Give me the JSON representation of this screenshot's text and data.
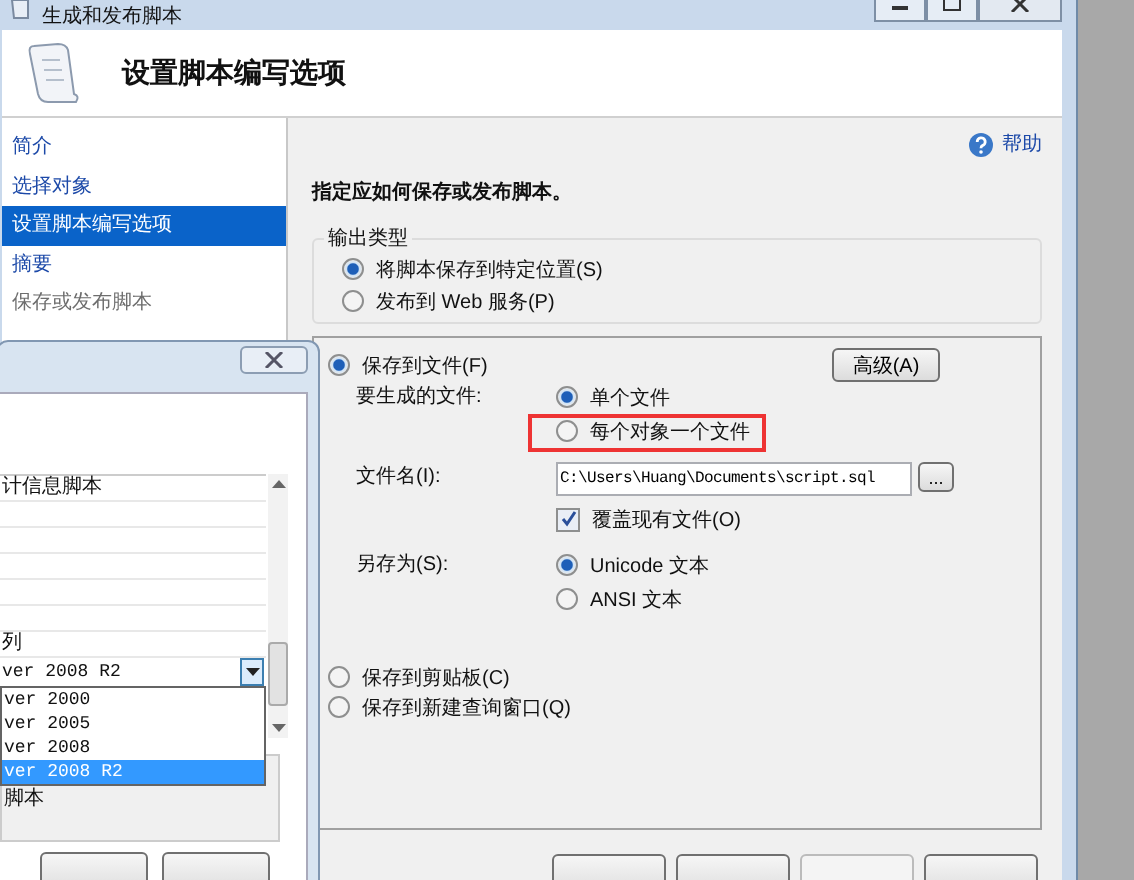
{
  "window": {
    "title": "生成和发布脚本"
  },
  "header": {
    "title": "设置脚本编写选项"
  },
  "nav": {
    "items": [
      {
        "label": "简介",
        "selected": false,
        "disabled": false
      },
      {
        "label": "选择对象",
        "selected": false,
        "disabled": false
      },
      {
        "label": "设置脚本编写选项",
        "selected": true,
        "disabled": false
      },
      {
        "label": "摘要",
        "selected": false,
        "disabled": false
      },
      {
        "label": "保存或发布脚本",
        "selected": false,
        "disabled": true
      }
    ]
  },
  "help": {
    "label": "帮助"
  },
  "instruction": "指定应如何保存或发布脚本。",
  "output_type": {
    "title": "输出类型",
    "options": [
      {
        "label": "将脚本保存到特定位置(S)",
        "selected": true
      },
      {
        "label": "发布到 Web 服务(P)",
        "selected": false
      }
    ]
  },
  "save_panel": {
    "save_to_file": {
      "label": "保存到文件(F)",
      "selected": true
    },
    "advanced_button": "高级(A)",
    "files_label": "要生成的文件:",
    "file_options": [
      {
        "label": "单个文件",
        "selected": true,
        "highlighted": false
      },
      {
        "label": "每个对象一个文件",
        "selected": false,
        "highlighted": true
      }
    ],
    "filename_label": "文件名(I):",
    "filename_value": "C:\\Users\\Huang\\Documents\\script.sql",
    "browse_button": "...",
    "overwrite": {
      "label": "覆盖现有文件(O)",
      "checked": true
    },
    "save_as_label": "另存为(S):",
    "encodings": [
      {
        "label": "Unicode 文本",
        "selected": true
      },
      {
        "label": "ANSI 文本",
        "selected": false
      }
    ],
    "other_destinations": [
      {
        "label": "保存到剪贴板(C)",
        "selected": false
      },
      {
        "label": "保存到新建查询窗口(Q)",
        "selected": false
      }
    ]
  },
  "wizard_buttons": [
    {
      "disabled": false
    },
    {
      "disabled": false
    },
    {
      "disabled": true
    },
    {
      "disabled": false
    }
  ],
  "front_dialog": {
    "list_rows": [
      "计信息脚本",
      "列"
    ],
    "combo": {
      "value": "ver 2008 R2",
      "options": [
        {
          "label": "ver 2000",
          "selected": false
        },
        {
          "label": "ver 2005",
          "selected": false
        },
        {
          "label": "ver 2008",
          "selected": false
        },
        {
          "label": "ver 2008 R2",
          "selected": true
        }
      ]
    },
    "description": "脚本",
    "buttons": [
      {
        "disabled": false
      },
      {
        "disabled": false
      }
    ]
  }
}
